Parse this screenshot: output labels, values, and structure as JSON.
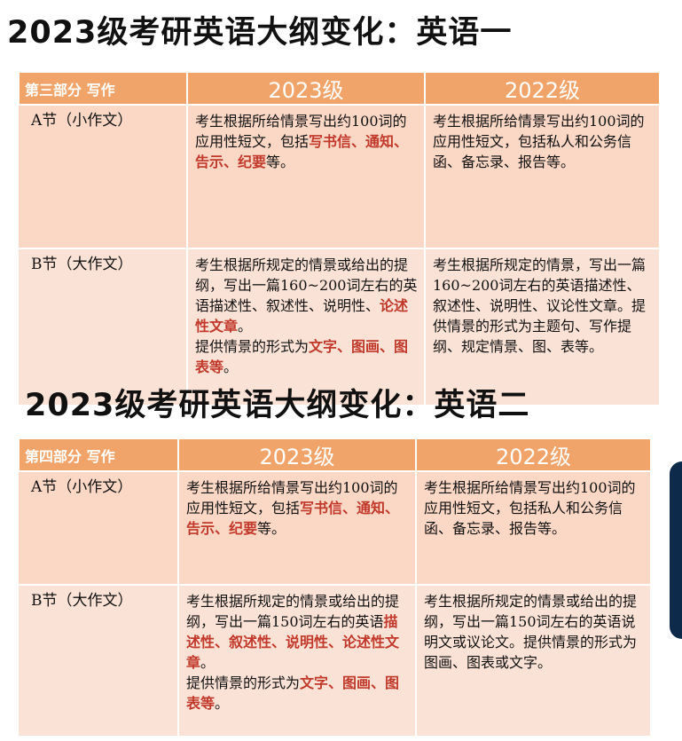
{
  "titles": {
    "english_one": "2023级考研英语大纲变化：英语一",
    "english_two": "2023级考研英语大纲变化：英语二"
  },
  "table_one": {
    "header": {
      "section": "第三部分 写作",
      "col_2023": "2023级",
      "col_2022": "2022级"
    },
    "rows": [
      {
        "label": "A节（小作文）",
        "y2023": {
          "parts": [
            "考生根据所给情景写出约100词的应用性短文，包括",
            "写书信、通知、告示、纪要",
            "等。"
          ]
        },
        "y2022": "考生根据所给情景写出约100词的应用性短文，包括私人和公务信函、备忘录、报告等。"
      },
      {
        "label": "B节（大作文）",
        "y2023": {
          "parts": [
            "考生根据所规定的情景或给出的提纲，写出一篇160~200词左右的英语描述性、叙述性、说明性、",
            "论述性文章",
            "。",
            "提供情景的形式为",
            "文字、图画、图表等",
            "。"
          ]
        },
        "y2022": "考生根据所规定的情景，写出一篇160~200词左右的英语描述性、叙述性、说明性、议论性文章。提供情景的形式为主题句、写作提纲、规定情景、图、表等。"
      }
    ]
  },
  "table_two": {
    "header": {
      "section": "第四部分 写作",
      "col_2023": "2023级",
      "col_2022": "2022级"
    },
    "rows": [
      {
        "label": "A节（小作文）",
        "y2023": {
          "parts": [
            "考生根据所给情景写出约100词的应用性短文，包括",
            "写书信、通知、告示、纪要",
            "等。"
          ]
        },
        "y2022": "考生根据所给情景写出约100词的应用性短文，包括私人和公务信函、备忘录、报告等。"
      },
      {
        "label": "B节（大作文）",
        "y2023": {
          "parts": [
            "考生根据所规定的情景或给出的提纲，写出一篇150词左右的英语",
            "描述性、叙述性、说明性、论述性文章",
            "。",
            "提供情景的形式为",
            "文字、图画、图表等",
            "。"
          ]
        },
        "y2022": "考生根据所规定的情景或给出的提纲，写出一篇150词左右的英语说明文或议论文。提供情景的形式为图画、图表或文字。"
      }
    ]
  },
  "colors": {
    "header_orange": "#f1a46a",
    "row_peach": "#fbd7c6",
    "highlight_red": "#c0392b"
  }
}
